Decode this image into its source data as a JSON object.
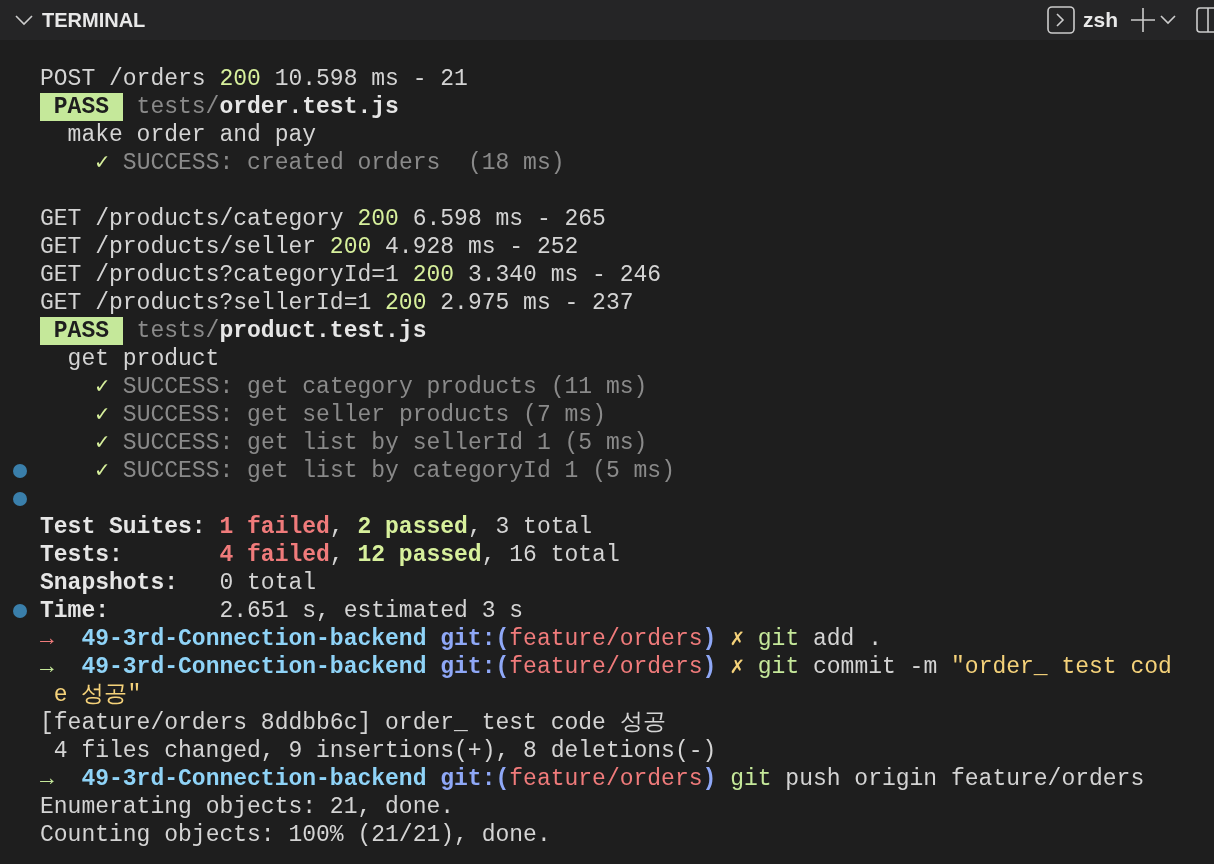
{
  "panel": {
    "title": "TERMINAL",
    "shell": "zsh"
  },
  "lines": [
    {
      "kind": "text",
      "marker": false,
      "segments": [
        {
          "text": "POST /orders",
          "kind": "plain"
        },
        {
          "text": "200",
          "kind": "status"
        },
        {
          "text": "10.598 ms - 21",
          "kind": "plain"
        }
      ]
    },
    {
      "kind": "suite",
      "marker": false,
      "segments": [
        {
          "text": "PASS",
          "kind": "pass"
        },
        {
          "text": "tests/",
          "kind": "path"
        },
        {
          "text": "order.test.js",
          "kind": "file"
        }
      ]
    },
    {
      "kind": "describe",
      "marker": false,
      "segments": [
        {
          "text": "make order and pay",
          "kind": "plain"
        }
      ]
    },
    {
      "kind": "result",
      "marker": false,
      "segments": [
        {
          "text": "✓",
          "kind": "check"
        },
        {
          "text": "SUCCESS: created orders  (18 ms)",
          "kind": "dim"
        }
      ]
    },
    {
      "kind": "blank",
      "marker": false
    },
    {
      "kind": "text",
      "marker": false,
      "segments": [
        {
          "text": "GET /products/category",
          "kind": "plain"
        },
        {
          "text": "200",
          "kind": "status"
        },
        {
          "text": "6.598 ms - 265",
          "kind": "plain"
        }
      ]
    },
    {
      "kind": "text",
      "marker": false,
      "segments": [
        {
          "text": "GET /products/seller",
          "kind": "plain"
        },
        {
          "text": "200",
          "kind": "status"
        },
        {
          "text": "4.928 ms - 252",
          "kind": "plain"
        }
      ]
    },
    {
      "kind": "text",
      "marker": false,
      "segments": [
        {
          "text": "GET /products?categoryId=1",
          "kind": "plain"
        },
        {
          "text": "200",
          "kind": "status"
        },
        {
          "text": "3.340 ms - 246",
          "kind": "plain"
        }
      ]
    },
    {
      "kind": "text",
      "marker": false,
      "segments": [
        {
          "text": "GET /products?sellerId=1",
          "kind": "plain"
        },
        {
          "text": "200",
          "kind": "status"
        },
        {
          "text": "2.975 ms - 237",
          "kind": "plain"
        }
      ]
    },
    {
      "kind": "suite",
      "marker": false,
      "segments": [
        {
          "text": "PASS",
          "kind": "pass"
        },
        {
          "text": "tests/",
          "kind": "path"
        },
        {
          "text": "product.test.js",
          "kind": "file"
        }
      ]
    },
    {
      "kind": "describe",
      "marker": false,
      "segments": [
        {
          "text": "get product",
          "kind": "plain"
        }
      ]
    },
    {
      "kind": "result",
      "marker": false,
      "segments": [
        {
          "text": "✓",
          "kind": "check"
        },
        {
          "text": "SUCCESS: get category products (11 ms)",
          "kind": "dim"
        }
      ]
    },
    {
      "kind": "result",
      "marker": false,
      "segments": [
        {
          "text": "✓",
          "kind": "check"
        },
        {
          "text": "SUCCESS: get seller products (7 ms)",
          "kind": "dim"
        }
      ]
    },
    {
      "kind": "result",
      "marker": false,
      "segments": [
        {
          "text": "✓",
          "kind": "check"
        },
        {
          "text": "SUCCESS: get list by sellerId 1 (5 ms)",
          "kind": "dim"
        }
      ]
    },
    {
      "kind": "result",
      "marker": true,
      "segments": [
        {
          "text": "✓",
          "kind": "check"
        },
        {
          "text": "SUCCESS: get list by categoryId 1 (5 ms)",
          "kind": "dim"
        }
      ]
    },
    {
      "kind": "blank",
      "marker": true
    },
    {
      "kind": "text",
      "marker": false,
      "segments": [
        {
          "text": "Test Suites:",
          "kind": "label"
        },
        {
          "text": "1 failed",
          "kind": "fail"
        },
        {
          "text": ",",
          "kind": "sep"
        },
        {
          "text": "2 passed",
          "kind": "passed"
        },
        {
          "text": ", 3 total",
          "kind": "plain"
        }
      ]
    },
    {
      "kind": "text",
      "marker": false,
      "segments": [
        {
          "text": "Tests:",
          "kind": "label"
        },
        {
          "text": "4 failed",
          "kind": "fail"
        },
        {
          "text": ",",
          "kind": "sep"
        },
        {
          "text": "12 passed",
          "kind": "passed"
        },
        {
          "text": ", 16 total",
          "kind": "plain"
        }
      ]
    },
    {
      "kind": "text",
      "marker": false,
      "segments": [
        {
          "text": "Snapshots:",
          "kind": "label"
        },
        {
          "text": "0 total",
          "kind": "plain"
        }
      ]
    },
    {
      "kind": "text",
      "marker": true,
      "segments": [
        {
          "text": "Time:",
          "kind": "label"
        },
        {
          "text": "2.651 s, estimated 3 s",
          "kind": "plain"
        }
      ]
    },
    {
      "kind": "text",
      "marker": false,
      "segments": [
        {
          "text": "→",
          "kind": "arrow-fail"
        },
        {
          "text": "49-3rd-Connection-backend",
          "kind": "repo"
        },
        {
          "text": "git:(",
          "kind": "git"
        },
        {
          "text": "feature/orders",
          "kind": "branch"
        },
        {
          "text": ")",
          "kind": "git"
        },
        {
          "text": "✗",
          "kind": "dirty"
        },
        {
          "text": "git",
          "kind": "cmd"
        },
        {
          "text": "add .",
          "kind": "arg"
        }
      ]
    },
    {
      "kind": "text",
      "marker": false,
      "segments": [
        {
          "text": "→",
          "kind": "arrow-ok"
        },
        {
          "text": "49-3rd-Connection-backend",
          "kind": "repo"
        },
        {
          "text": "git:(",
          "kind": "git"
        },
        {
          "text": "feature/orders",
          "kind": "branch"
        },
        {
          "text": ")",
          "kind": "git"
        },
        {
          "text": "✗",
          "kind": "dirty"
        },
        {
          "text": "git",
          "kind": "cmd"
        },
        {
          "text": "commit -m",
          "kind": "arg"
        },
        {
          "text": "\"order_ test cod",
          "kind": "string"
        }
      ]
    },
    {
      "kind": "text",
      "marker": false,
      "segments": [
        {
          "text": "e 성공\"",
          "kind": "string"
        }
      ]
    },
    {
      "kind": "text",
      "marker": false,
      "segments": [
        {
          "text": "[feature/orders 8ddbb6c] order_ test code 성공",
          "kind": "plain"
        }
      ]
    },
    {
      "kind": "text",
      "marker": false,
      "segments": [
        {
          "text": "4 files changed, 9 insertions(+), 8 deletions(-)",
          "kind": "stat"
        }
      ]
    },
    {
      "kind": "text",
      "marker": false,
      "segments": [
        {
          "text": "→",
          "kind": "arrow-ok"
        },
        {
          "text": "49-3rd-Connection-backend",
          "kind": "repo"
        },
        {
          "text": "git:(",
          "kind": "git"
        },
        {
          "text": "feature/orders",
          "kind": "branch"
        },
        {
          "text": ")",
          "kind": "git"
        },
        {
          "text": "git",
          "kind": "cmd"
        },
        {
          "text": "push origin feature/orders",
          "kind": "arg"
        }
      ]
    },
    {
      "kind": "text",
      "marker": false,
      "segments": [
        {
          "text": "Enumerating objects: 21, done.",
          "kind": "plain"
        }
      ]
    },
    {
      "kind": "text",
      "marker": false,
      "segments": [
        {
          "text": "Counting objects: 100% (21/21), done.",
          "kind": "plain"
        }
      ]
    }
  ]
}
